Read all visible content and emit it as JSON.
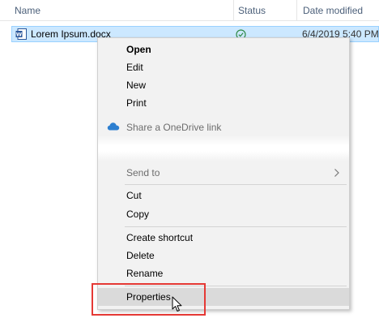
{
  "columns": {
    "name": "Name",
    "status": "Status",
    "date_modified": "Date modified"
  },
  "file": {
    "name": "Lorem Ipsum.docx",
    "date_modified": "6/4/2019 5:40 PM",
    "icon": "word-document-icon",
    "status_icon": "synced-check-icon"
  },
  "menu": {
    "items": [
      {
        "label": "Open",
        "style": "bold"
      },
      {
        "label": "Edit"
      },
      {
        "label": "New"
      },
      {
        "label": "Print"
      },
      {
        "label": "Share a OneDrive link",
        "icon": "onedrive-cloud-icon"
      },
      {
        "label": "Send to",
        "submenu": true
      },
      {
        "label": "Cut"
      },
      {
        "label": "Copy"
      },
      {
        "label": "Create shortcut"
      },
      {
        "label": "Delete"
      },
      {
        "label": "Rename"
      },
      {
        "label": "Properties",
        "state": "hovered"
      }
    ]
  },
  "colors": {
    "selection": "#cce8ff",
    "highlight_box": "#e53935",
    "menu_background": "#f2f2f2"
  }
}
